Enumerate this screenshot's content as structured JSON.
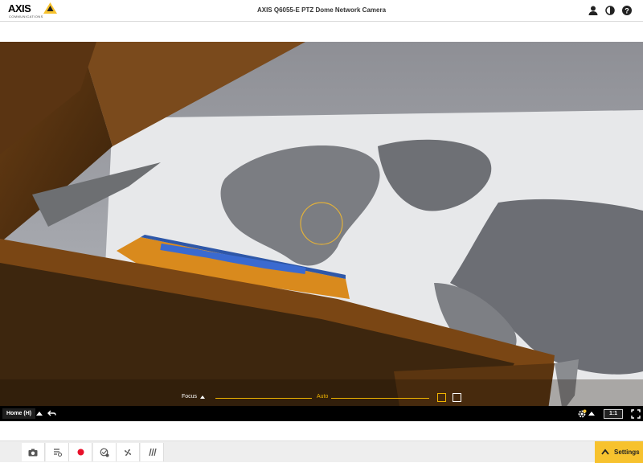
{
  "header": {
    "brand": "AXIS",
    "brand_sub": "COMMUNICATIONS",
    "title": "AXIS Q6055-E PTZ Dome Network Camera",
    "icons": [
      "user-icon",
      "contrast-icon",
      "help-icon"
    ]
  },
  "video": {
    "focus_label": "Focus",
    "focus_mode": "Auto",
    "preset_label": "Home (H)",
    "ratio_label": "1:1"
  },
  "toolbar": {
    "tools": [
      "camera-snapshot-icon",
      "stream-profile-icon",
      "record-icon",
      "ptz-control-icon",
      "fan-icon",
      "wiper-icon"
    ],
    "settings_label": "Settings"
  },
  "colors": {
    "accent": "#f0b400",
    "settings_bg": "#f7c22e",
    "record": "#e8102a"
  }
}
